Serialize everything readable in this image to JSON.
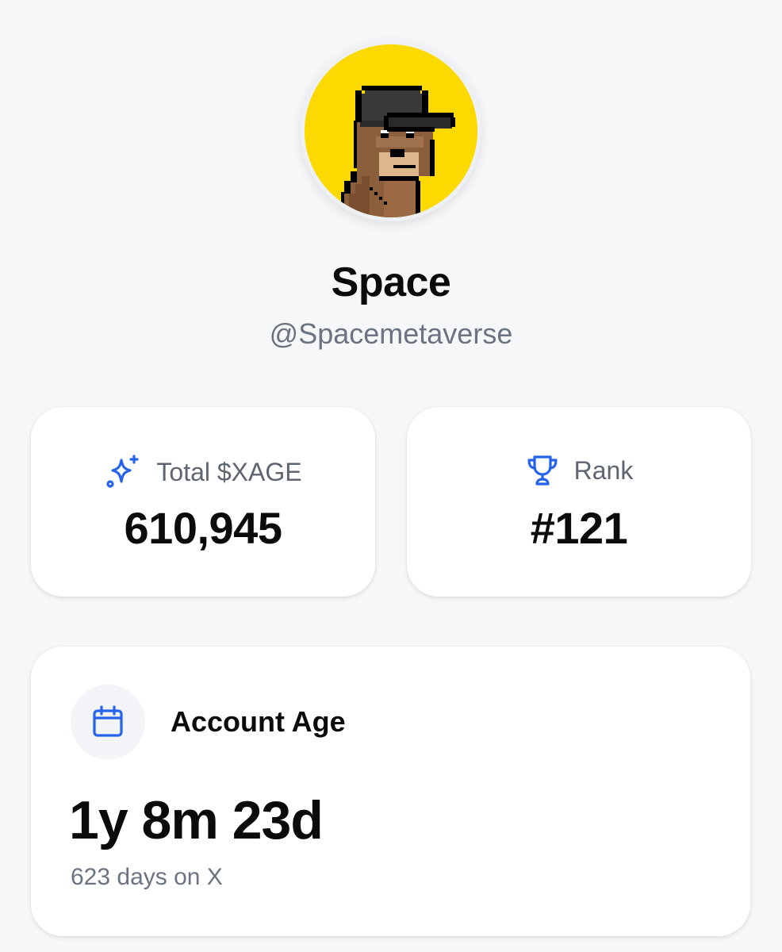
{
  "profile": {
    "name": "Space",
    "handle": "@Spacemetaverse",
    "avatar_icon": "pixel-bear-with-black-cap",
    "avatar_background": "#fcd901"
  },
  "stats": {
    "xage": {
      "icon": "sparkles-icon",
      "label": "Total $XAGE",
      "value": "610,945"
    },
    "rank": {
      "icon": "trophy-icon",
      "label": "Rank",
      "value": "#121"
    }
  },
  "account_age": {
    "icon": "calendar-icon",
    "title": "Account Age",
    "value": "1y 8m 23d",
    "subtitle": "623 days on X"
  },
  "colors": {
    "accent": "#2563eb",
    "muted_text": "#6b7280",
    "background": "#f6f7f9"
  }
}
